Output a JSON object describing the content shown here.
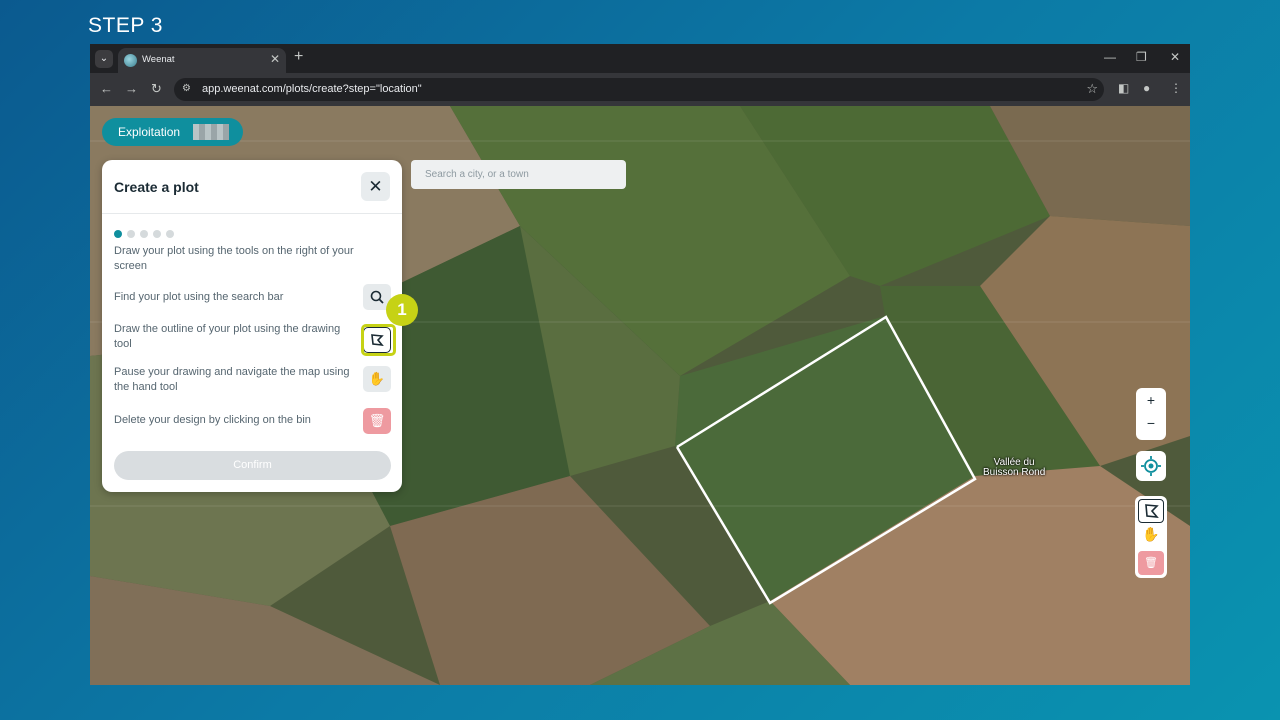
{
  "step_label": "STEP 3",
  "browser": {
    "tab_title": "Weenat",
    "url": "app.weenat.com/plots/create?step=\"location\""
  },
  "app": {
    "exploitation_label": "Exploitation",
    "panel": {
      "title": "Create a plot",
      "intro": "Draw your plot using the tools on the right of your screen",
      "steps": [
        {
          "text": "Find your plot using the search bar",
          "icon": "search-location-icon"
        },
        {
          "text": "Draw the outline of your plot using the drawing tool",
          "icon": "draw-polygon-icon"
        },
        {
          "text": "Pause your drawing and navigate the map using the hand tool",
          "icon": "hand-icon"
        },
        {
          "text": "Delete your design by clicking on the bin",
          "icon": "trash-icon"
        }
      ],
      "confirm_label": "Confirm",
      "progress_step": 1,
      "progress_total": 5
    },
    "search": {
      "placeholder": "Search a city, or a town"
    },
    "map": {
      "place_label_line1": "Vallée du",
      "place_label_line2": "Buisson Rond"
    },
    "callout_number": "1",
    "colors": {
      "accent": "#0f8f9e",
      "highlight": "#c6d215",
      "delete": "#ee9aa0"
    }
  }
}
